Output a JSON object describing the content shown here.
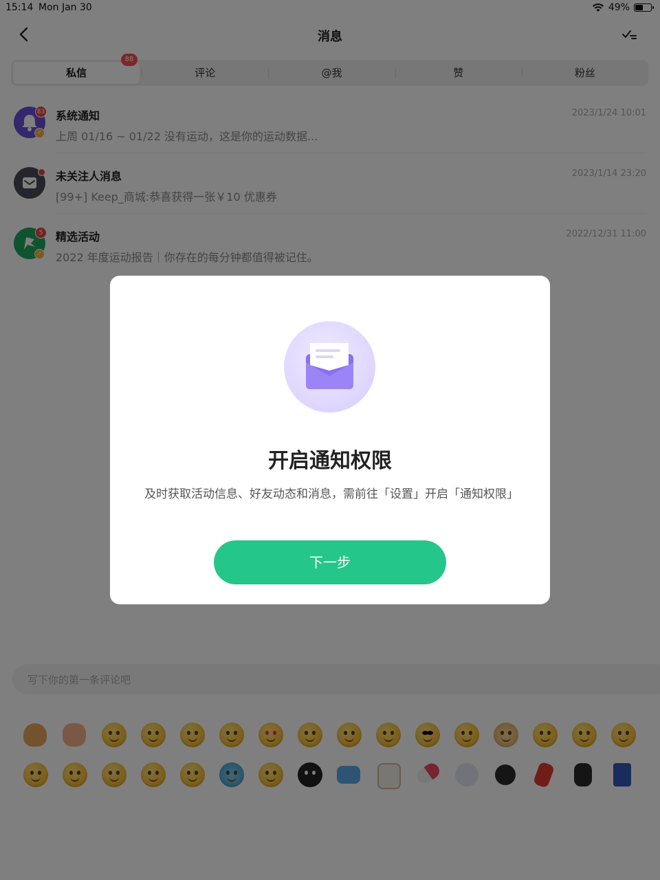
{
  "status_bar": {
    "time": "15:14",
    "date": "Mon Jan 30",
    "battery": "49%"
  },
  "nav": {
    "title": "消息"
  },
  "tabs": [
    {
      "label": "私信",
      "active": true,
      "badge": "88"
    },
    {
      "label": "评论"
    },
    {
      "label": "@我"
    },
    {
      "label": "赞"
    },
    {
      "label": "粉丝"
    }
  ],
  "messages": [
    {
      "name": "系统通知",
      "preview": "上周 01/16 ~ 01/22 没有运动，这是你的运动数据...",
      "time": "2023/1/24 10:01",
      "badge": "83",
      "avatar_color": "#6b4fd8",
      "icon": "bell-icon"
    },
    {
      "name": "未关注人消息",
      "preview": "[99+] Keep_商城:恭喜获得一张￥10 优惠券",
      "time": "2023/1/14 23:20",
      "badge_dot": true,
      "avatar_color": "#4a4a5a",
      "icon": "mail-icon"
    },
    {
      "name": "精选活动",
      "preview": "2022 年度运动报告｜你存在的每分钟都值得被记住。",
      "time": "2022/12/31 11:00",
      "badge": "5",
      "avatar_color": "#1fa85e",
      "icon": "flag-icon"
    }
  ],
  "comment_input": {
    "placeholder": "写下你的第一条评论吧"
  },
  "modal": {
    "title": "开启通知权限",
    "description": "及时获取活动信息、好友动态和消息，需前往「设置」开启「通知权限」",
    "button": "下一步"
  },
  "colors": {
    "accent": "#24c789",
    "badge": "#e84545",
    "envelope": "#8a6ff0"
  }
}
